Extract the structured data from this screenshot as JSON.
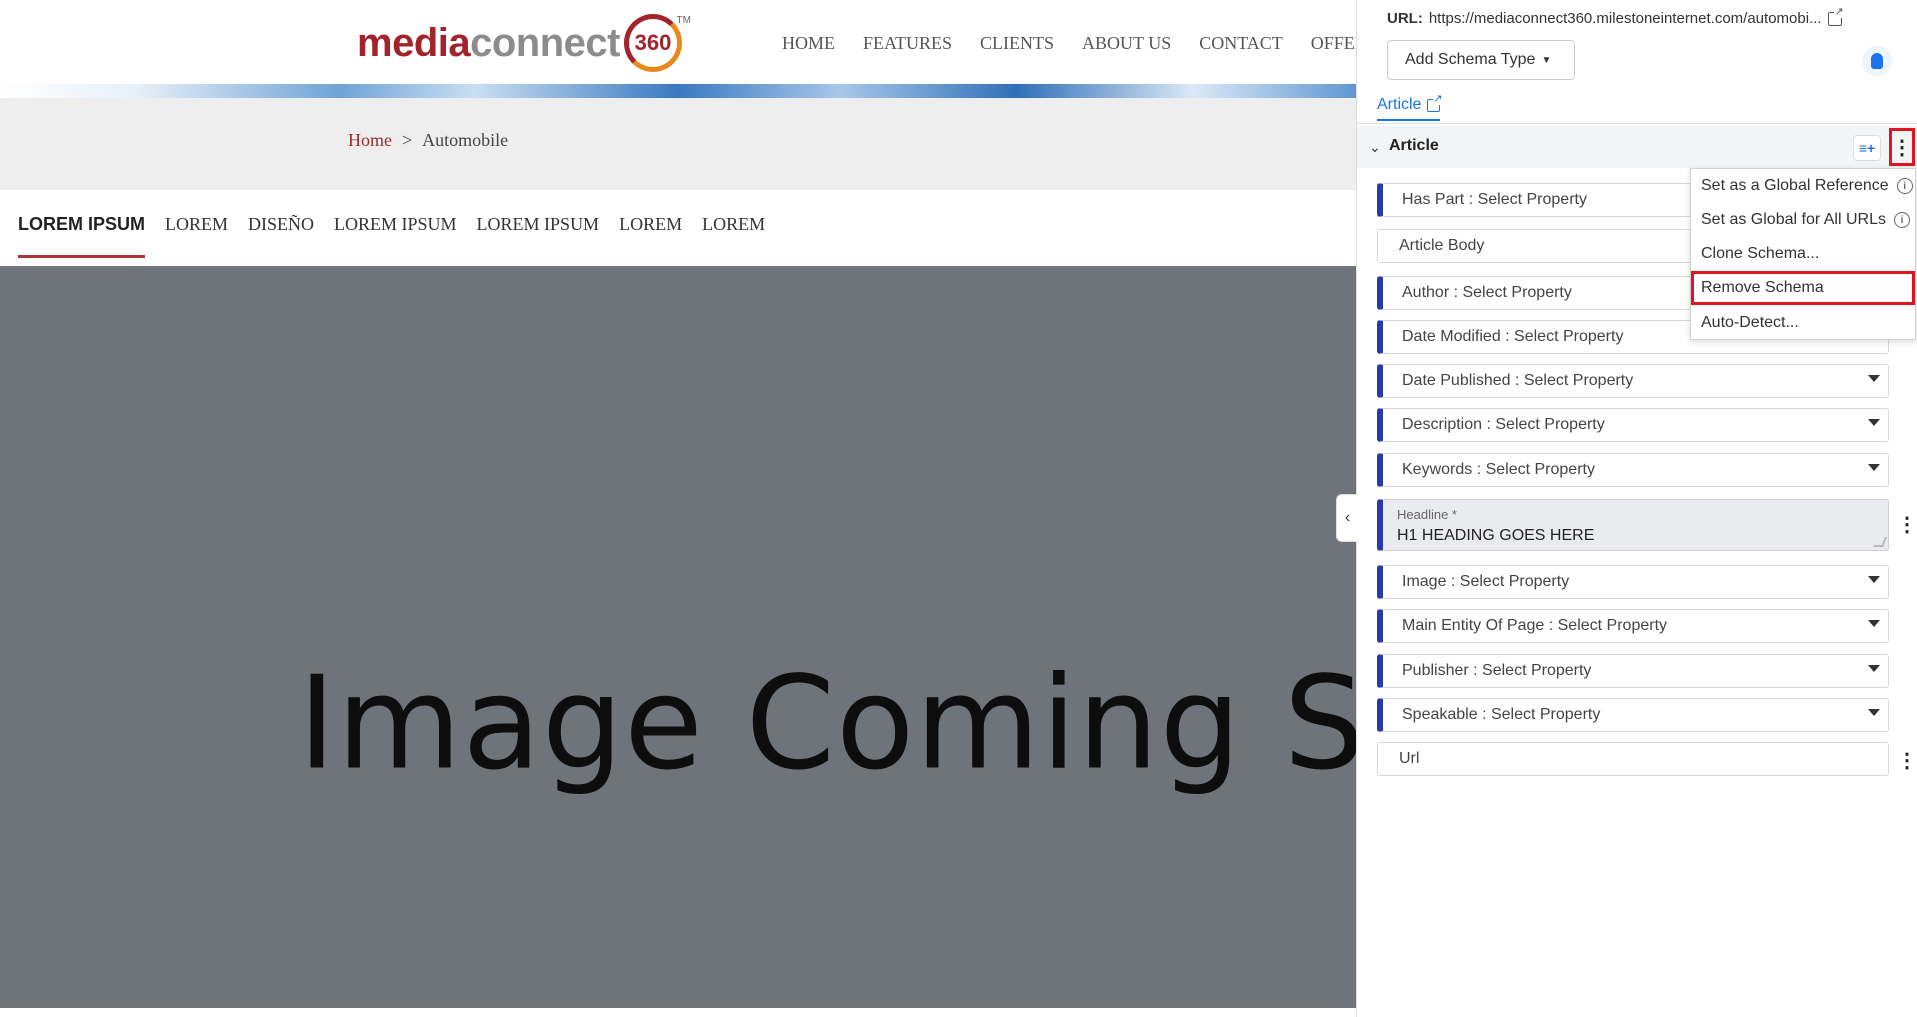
{
  "site": {
    "logo": {
      "media": "media",
      "connect": "connect",
      "badge": "360",
      "tm": "TM"
    },
    "nav": [
      "HOME",
      "FEATURES",
      "CLIENTS",
      "ABOUT US",
      "CONTACT",
      "OFFER"
    ],
    "breadcrumb": {
      "home": "Home",
      "separator": ">",
      "current": "Automobile"
    },
    "subnav": [
      "LOREM IPSUM",
      "LOREM",
      "DISEÑO",
      "LOREM IPSUM",
      "LOREM IPSUM",
      "LOREM",
      "LOREM"
    ],
    "hero_text": "Image Coming S",
    "colors": {
      "brand": "#a3232a",
      "hero_bg": "#6f737a"
    }
  },
  "panel": {
    "url_label": "URL:",
    "url_value": "https://mediaconnect360.milestoneinternet.com/automobi...",
    "add_schema_label": "Add Schema Type",
    "tab_label": "Article",
    "section_title": "Article",
    "fields": [
      "Has Part : Select Property",
      "Article Body",
      "Author : Select Property",
      "Date Modified : Select Property",
      "Date Published : Select Property",
      "Description : Select Property",
      "Keywords : Select Property"
    ],
    "headline": {
      "label": "Headline *",
      "value": "H1 HEADING GOES HERE"
    },
    "fields_after": [
      "Image : Select Property",
      "Main Entity Of Page : Select Property",
      "Publisher : Select Property",
      "Speakable : Select Property",
      "Url"
    ],
    "menu": [
      "Set as a Global Reference",
      "Set as Global for All URLs",
      "Clone Schema...",
      "Remove Schema",
      "Auto-Detect..."
    ],
    "colors": {
      "accent": "#1a73e8",
      "field_bar": "#2a3aa8",
      "highlight": "#e0141e"
    }
  }
}
